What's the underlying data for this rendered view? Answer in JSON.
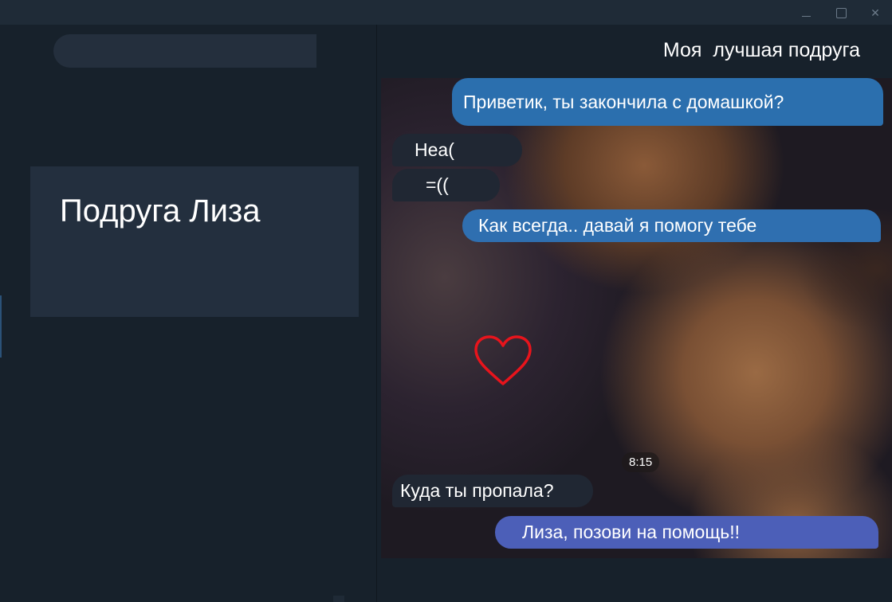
{
  "window": {
    "close_glyph": "✕"
  },
  "search": {
    "placeholder": ""
  },
  "chat_list": {
    "items": [
      {
        "name": "Подруга Лиза"
      }
    ]
  },
  "chat": {
    "title": "Моя  лучшая подруга",
    "messages": [
      {
        "direction": "outgoing",
        "text": "Приветик, ты закончила с домашкой?"
      },
      {
        "direction": "incoming",
        "text": "Неа("
      },
      {
        "direction": "incoming",
        "text": "=(("
      },
      {
        "direction": "outgoing",
        "text": "Как всегда.. давай я помогу тебе"
      },
      {
        "direction": "incoming",
        "text": "Куда ты пропала?"
      },
      {
        "direction": "outgoing",
        "text": "Лиза, позови на помощь!!"
      }
    ],
    "time_badge": "8:15",
    "decoration_icon": "heart-outline"
  },
  "colors": {
    "sidebar_bg": "#17212b",
    "selected_chat_bg": "#232f3e",
    "outgoing_bubble": "#2b6fae",
    "outgoing_bubble_alt": "#4c5fb8",
    "incoming_bubble": "#202733",
    "heart": "#e8141c"
  }
}
